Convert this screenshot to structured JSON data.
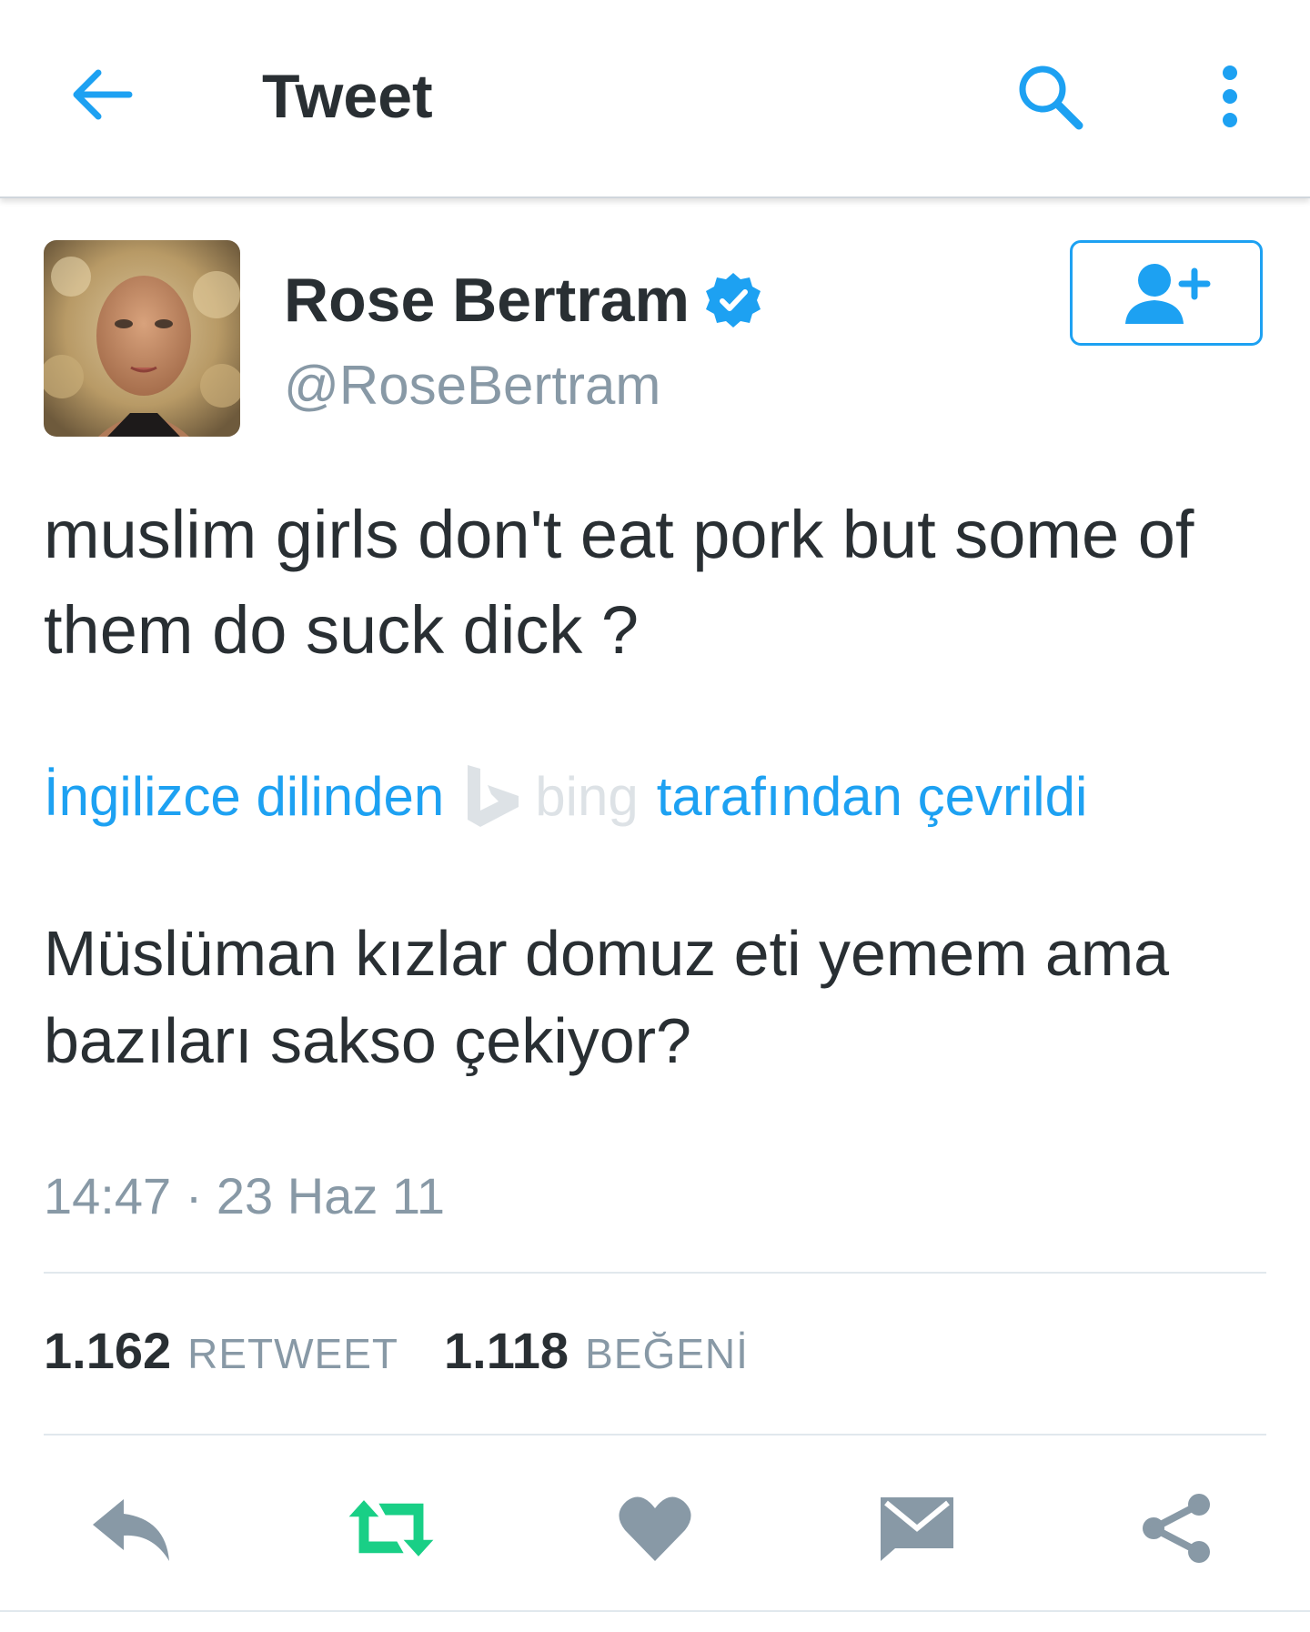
{
  "header": {
    "title": "Tweet",
    "back_icon": "back-arrow-icon",
    "search_icon": "search-icon",
    "more_icon": "more-vertical-icon"
  },
  "author": {
    "display_name": "Rose Bertram",
    "handle": "@RoseBertram",
    "verified": true,
    "avatar_icon": "avatar"
  },
  "follow_button": {
    "icon": "add-user-icon"
  },
  "tweet": {
    "text": "muslim girls don't eat pork but some of them do suck dick ?",
    "translation": {
      "prefix": "İngilizce dilinden",
      "provider": "bing",
      "suffix": "tarafından çevrildi"
    },
    "translated_text": "Müslüman kızlar domuz eti yemem ama bazıları sakso çekiyor?",
    "timestamp": "14:47 · 23 Haz 11"
  },
  "stats": {
    "retweets": {
      "count": "1.162",
      "label": "RETWEET"
    },
    "likes": {
      "count": "1.118",
      "label": "BEĞENİ"
    }
  },
  "actions": {
    "reply_icon": "reply-icon",
    "retweet_icon": "retweet-icon",
    "like_icon": "heart-icon",
    "message_icon": "envelope-icon",
    "share_icon": "share-icon"
  },
  "colors": {
    "accent": "#1da1f2",
    "text": "#292f33",
    "muted": "#8899a6",
    "action_icon": "#8899a6",
    "retweet_active": "#19cf86",
    "divider": "#e1e8ed"
  }
}
